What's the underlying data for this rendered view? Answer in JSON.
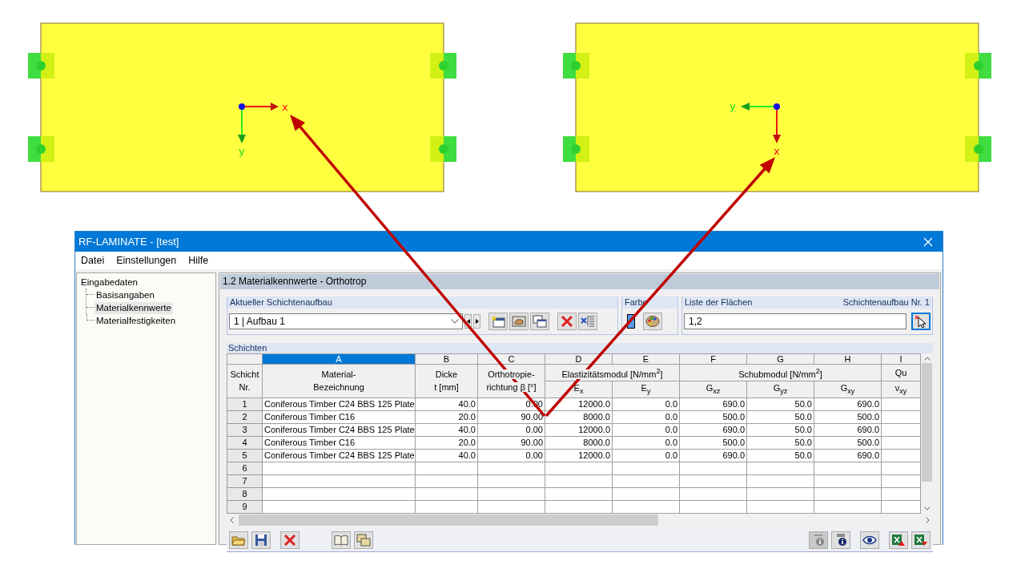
{
  "diagrams": [
    {
      "kind": "x-right",
      "x_label": "x",
      "y_label": "y"
    },
    {
      "kind": "x-down",
      "x_label": "x",
      "y_label": "y"
    }
  ],
  "window": {
    "title": "RF-LAMINATE - [test]"
  },
  "menu": [
    "Datei",
    "Einstellungen",
    "Hilfe"
  ],
  "tree": {
    "label": "Eingabedaten",
    "children": [
      {
        "label": "Basisangaben",
        "selected": false
      },
      {
        "label": "Materialkennwerte",
        "selected": true
      },
      {
        "label": "Materialfestigkeiten",
        "selected": false
      }
    ]
  },
  "panel_title": "1.2 Materialkennwerte - Orthotrop",
  "layer_setup": {
    "label": "Aktueller Schichtenaufbau",
    "value": "1 | Aufbau 1"
  },
  "color_group": {
    "label": "Farbe",
    "color": "#5599ee"
  },
  "surfaces": {
    "label": "Liste der Flächen",
    "caption": "Schichtenaufbau Nr. 1",
    "value": "1,2"
  },
  "table": {
    "label": "Schichten",
    "row_header": [
      "Schicht",
      "Nr."
    ],
    "groups": [
      {
        "kind": "single",
        "letter": "A",
        "selected": true,
        "lines": [
          "Material-",
          "Bezeichnung"
        ]
      },
      {
        "kind": "single",
        "letter": "B",
        "selected": false,
        "lines": [
          "Dicke",
          "t [mm]"
        ]
      },
      {
        "kind": "single",
        "letter": "C",
        "selected": false,
        "lines": [
          "Orthotropie-",
          "richtung β [°]"
        ]
      },
      {
        "kind": "group",
        "title": "Elastizitätsmodul [N/mm$^{2}$]",
        "columns": [
          {
            "letter": "D",
            "selected": false,
            "label": "E$_{x}$"
          },
          {
            "letter": "E",
            "selected": false,
            "label": "E$_{y}$"
          }
        ]
      },
      {
        "kind": "group",
        "title": "Schubmodul [N/mm$^{2}$]",
        "columns": [
          {
            "letter": "F",
            "selected": false,
            "label": "G$_{xz}$"
          },
          {
            "letter": "G",
            "selected": false,
            "label": "G$_{yz}$"
          },
          {
            "letter": "H",
            "selected": false,
            "label": "G$_{xy}$"
          }
        ]
      },
      {
        "kind": "group",
        "title": "Qu",
        "columns": [
          {
            "letter": "I",
            "selected": false,
            "label": "ν$_{xy}$"
          }
        ]
      }
    ],
    "rows": [
      {
        "nr": "1",
        "cells": [
          "Coniferous Timber C24 BBS 125 Plate",
          "40.0",
          "0.00",
          "12000.0",
          "0.0",
          "690.0",
          "50.0",
          "690.0"
        ]
      },
      {
        "nr": "2",
        "cells": [
          "Coniferous Timber C16",
          "20.0",
          "90.00",
          "8000.0",
          "0.0",
          "500.0",
          "50.0",
          "500.0"
        ]
      },
      {
        "nr": "3",
        "cells": [
          "Coniferous Timber C24 BBS 125 Plate",
          "40.0",
          "0.00",
          "12000.0",
          "0.0",
          "690.0",
          "50.0",
          "690.0"
        ]
      },
      {
        "nr": "4",
        "cells": [
          "Coniferous Timber C16",
          "20.0",
          "90.00",
          "8000.0",
          "0.0",
          "500.0",
          "50.0",
          "500.0"
        ]
      },
      {
        "nr": "5",
        "cells": [
          "Coniferous Timber C24 BBS 125 Plate",
          "40.0",
          "0.00",
          "12000.0",
          "0.0",
          "690.0",
          "50.0",
          "690.0"
        ]
      },
      {
        "nr": "6"
      },
      {
        "nr": "7"
      },
      {
        "nr": "8"
      },
      {
        "nr": "9"
      }
    ]
  }
}
